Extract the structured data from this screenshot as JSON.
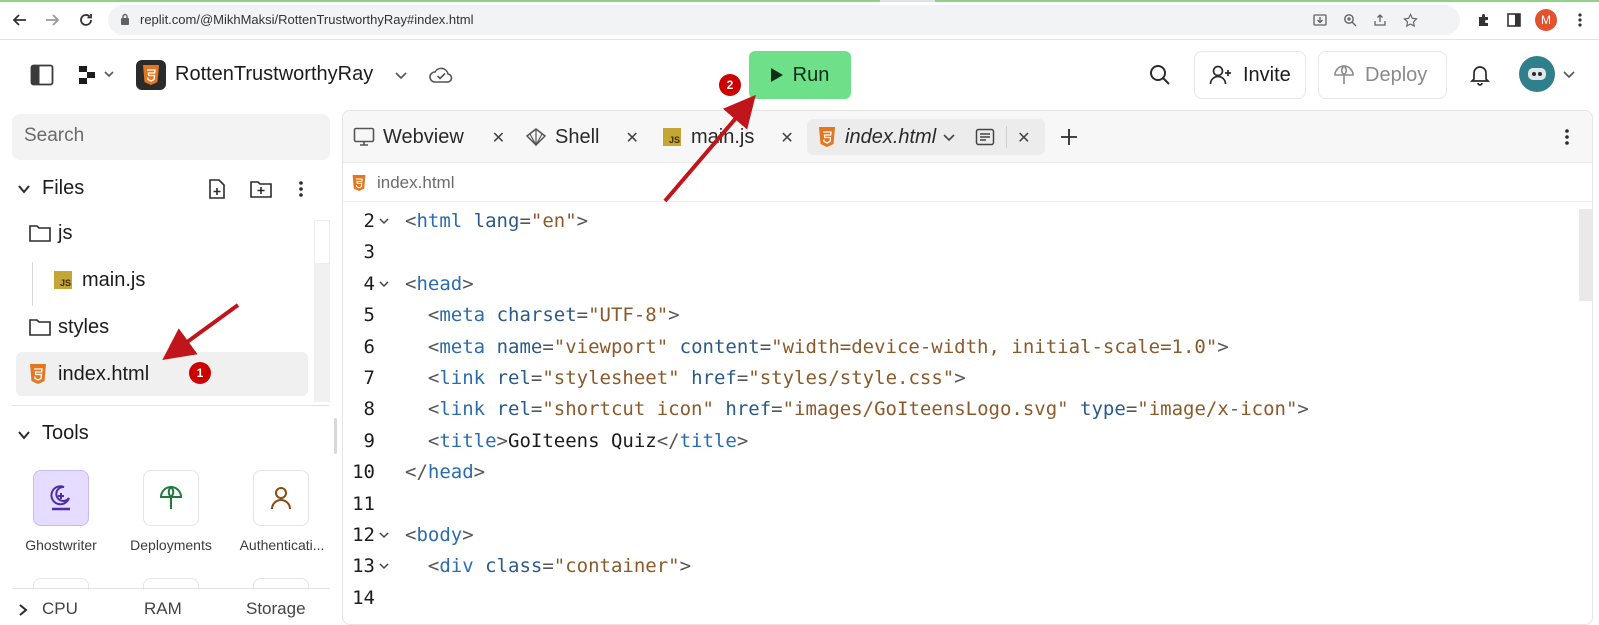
{
  "browser": {
    "url": "replit.com/@MikhMaksi/RottenTrustworthyRay#index.html",
    "profile_initial": "M",
    "icons": [
      "back-icon",
      "forward-icon",
      "reload-icon",
      "lock-icon",
      "install-icon",
      "zoom-icon",
      "share-icon",
      "star-icon",
      "extensions-icon",
      "sidepanel-icon",
      "menu-icon"
    ]
  },
  "header": {
    "repl_name": "RottenTrustworthyRay",
    "run_label": "Run",
    "invite_label": "Invite",
    "deploy_label": "Deploy",
    "run_color": "#6fe08a"
  },
  "sidebar": {
    "search_placeholder": "Search",
    "files_title": "Files",
    "files": [
      {
        "name": "js",
        "type": "folder"
      },
      {
        "name": "main.js",
        "type": "js"
      },
      {
        "name": "styles",
        "type": "folder"
      },
      {
        "name": "index.html",
        "type": "html",
        "selected": true
      }
    ],
    "tools_title": "Tools",
    "tools": [
      {
        "label": "Ghostwriter",
        "icon": "ghostwriter-icon"
      },
      {
        "label": "Deployments",
        "icon": "deployments-icon"
      },
      {
        "label": "Authenticati...",
        "icon": "user-icon"
      }
    ],
    "resources": [
      "CPU",
      "RAM",
      "Storage"
    ]
  },
  "editor": {
    "tabs": [
      {
        "label": "Webview",
        "icon": "monitor-icon"
      },
      {
        "label": "Shell",
        "icon": "shell-icon"
      },
      {
        "label": "main.js",
        "icon": "js-file-icon"
      },
      {
        "label": "index.html",
        "icon": "html-file-icon",
        "active": true
      }
    ],
    "breadcrumb": "index.html",
    "lines": [
      {
        "n": "2",
        "fold": true,
        "tokens": [
          [
            "pun",
            "<"
          ],
          [
            "tag",
            "html"
          ],
          [
            "txt",
            " "
          ],
          [
            "attr",
            "lang"
          ],
          [
            "pun",
            "="
          ],
          [
            "str",
            "\"en\""
          ],
          [
            "pun",
            ">"
          ]
        ]
      },
      {
        "n": "3",
        "fold": false,
        "tokens": []
      },
      {
        "n": "4",
        "fold": true,
        "tokens": [
          [
            "pun",
            "<"
          ],
          [
            "tag",
            "head"
          ],
          [
            "pun",
            ">"
          ]
        ]
      },
      {
        "n": "5",
        "fold": false,
        "tokens": [
          [
            "txt",
            "  "
          ],
          [
            "pun",
            "<"
          ],
          [
            "tag",
            "meta"
          ],
          [
            "txt",
            " "
          ],
          [
            "attr",
            "charset"
          ],
          [
            "pun",
            "="
          ],
          [
            "str",
            "\"UTF-8\""
          ],
          [
            "pun",
            ">"
          ]
        ]
      },
      {
        "n": "6",
        "fold": false,
        "tokens": [
          [
            "txt",
            "  "
          ],
          [
            "pun",
            "<"
          ],
          [
            "tag",
            "meta"
          ],
          [
            "txt",
            " "
          ],
          [
            "attr",
            "name"
          ],
          [
            "pun",
            "="
          ],
          [
            "str",
            "\"viewport\""
          ],
          [
            "txt",
            " "
          ],
          [
            "attr",
            "content"
          ],
          [
            "pun",
            "="
          ],
          [
            "str",
            "\"width=device-width, initial-scale=1.0\""
          ],
          [
            "pun",
            ">"
          ]
        ]
      },
      {
        "n": "7",
        "fold": false,
        "tokens": [
          [
            "txt",
            "  "
          ],
          [
            "pun",
            "<"
          ],
          [
            "tag",
            "link"
          ],
          [
            "txt",
            " "
          ],
          [
            "attr",
            "rel"
          ],
          [
            "pun",
            "="
          ],
          [
            "str",
            "\"stylesheet\""
          ],
          [
            "txt",
            " "
          ],
          [
            "attr",
            "href"
          ],
          [
            "pun",
            "="
          ],
          [
            "str",
            "\"styles/style.css\""
          ],
          [
            "pun",
            ">"
          ]
        ]
      },
      {
        "n": "8",
        "fold": false,
        "tokens": [
          [
            "txt",
            "  "
          ],
          [
            "pun",
            "<"
          ],
          [
            "tag",
            "link"
          ],
          [
            "txt",
            " "
          ],
          [
            "attr",
            "rel"
          ],
          [
            "pun",
            "="
          ],
          [
            "str",
            "\"shortcut icon\""
          ],
          [
            "txt",
            " "
          ],
          [
            "attr",
            "href"
          ],
          [
            "pun",
            "="
          ],
          [
            "str",
            "\"images/GoIteensLogo.svg\""
          ],
          [
            "txt",
            " "
          ],
          [
            "attr",
            "type"
          ],
          [
            "pun",
            "="
          ],
          [
            "str",
            "\"image/x-icon\""
          ],
          [
            "pun",
            ">"
          ]
        ]
      },
      {
        "n": "9",
        "fold": false,
        "tokens": [
          [
            "txt",
            "  "
          ],
          [
            "pun",
            "<"
          ],
          [
            "tag",
            "title"
          ],
          [
            "pun",
            ">"
          ],
          [
            "txt",
            "GoIteens Quiz"
          ],
          [
            "pun",
            "</"
          ],
          [
            "tag",
            "title"
          ],
          [
            "pun",
            ">"
          ]
        ]
      },
      {
        "n": "10",
        "fold": false,
        "tokens": [
          [
            "pun",
            "</"
          ],
          [
            "tag",
            "head"
          ],
          [
            "pun",
            ">"
          ]
        ]
      },
      {
        "n": "11",
        "fold": false,
        "tokens": []
      },
      {
        "n": "12",
        "fold": true,
        "tokens": [
          [
            "pun",
            "<"
          ],
          [
            "tag",
            "body"
          ],
          [
            "pun",
            ">"
          ]
        ]
      },
      {
        "n": "13",
        "fold": true,
        "tokens": [
          [
            "txt",
            "  "
          ],
          [
            "pun",
            "<"
          ],
          [
            "tag",
            "div"
          ],
          [
            "txt",
            " "
          ],
          [
            "attr",
            "class"
          ],
          [
            "pun",
            "="
          ],
          [
            "str",
            "\"container\""
          ],
          [
            "pun",
            ">"
          ]
        ]
      },
      {
        "n": "14",
        "fold": false,
        "tokens": []
      }
    ]
  },
  "annotations": {
    "badge_1": "1",
    "badge_2": "2",
    "arrow_color": "#c0161b"
  }
}
